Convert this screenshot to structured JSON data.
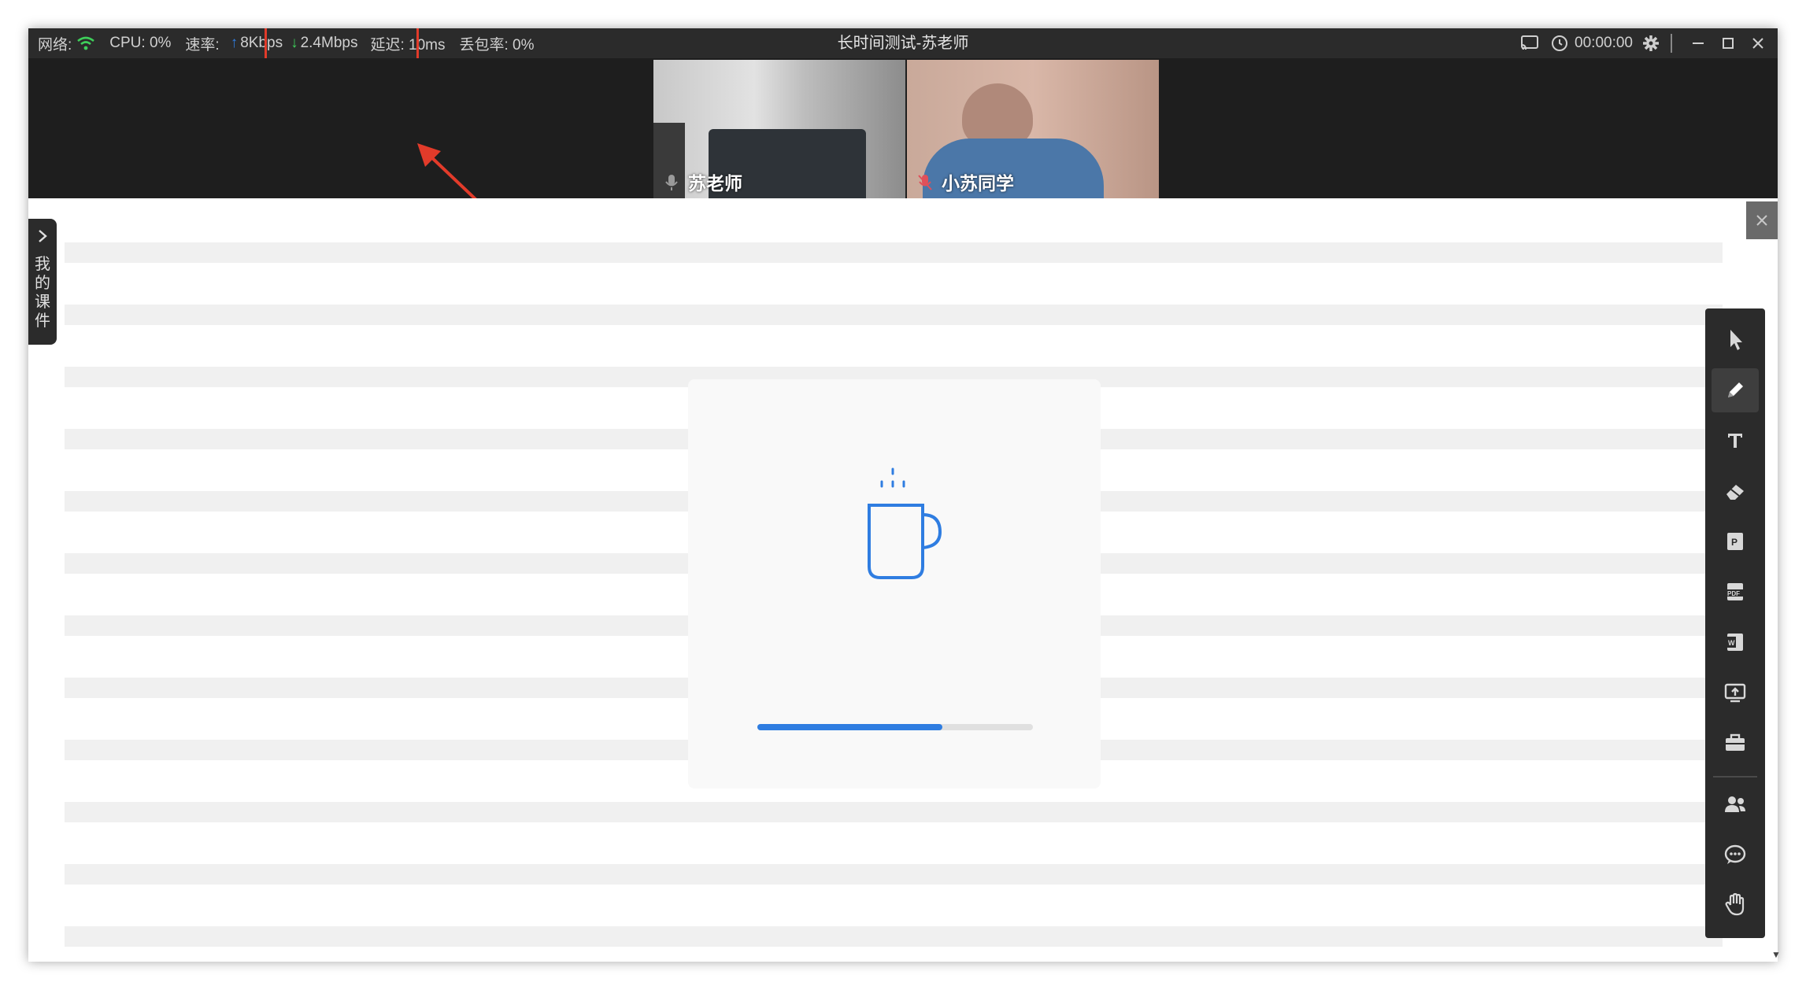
{
  "titlebar": {
    "network_label": "网络:",
    "cpu": "CPU: 0%",
    "rate_label": "速率:",
    "upload": "8Kbps",
    "download": "2.4Mbps",
    "latency": "延迟: 10ms",
    "packet_loss": "丢包率: 0%",
    "title": "长时间测试-苏老师",
    "timer": "00:00:00"
  },
  "videos": [
    {
      "name": "苏老师"
    },
    {
      "name": "小苏同学"
    }
  ],
  "sidebar": {
    "tab_label": "我的课件"
  },
  "loading": {
    "progress": 0.67
  },
  "toolbar": {
    "tools": [
      "cursor-icon",
      "pen-icon",
      "text-icon",
      "eraser-icon",
      "ppt-icon",
      "pdf-icon",
      "word-icon",
      "screen-share-icon",
      "toolbox-icon",
      "users-icon",
      "chat-icon",
      "raise-hand-icon"
    ],
    "active": "pen-icon"
  },
  "colors": {
    "highlight": "#e23b2a",
    "accent": "#2f7de1",
    "network_ok": "#3ecf5a",
    "dark_bg": "#2b2b2b"
  }
}
